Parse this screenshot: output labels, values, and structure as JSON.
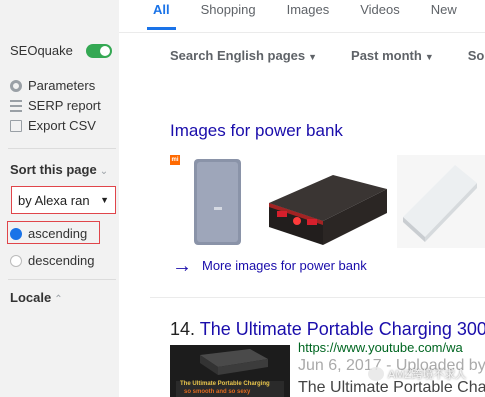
{
  "tabs": [
    "All",
    "Shopping",
    "Images",
    "Videos",
    "New"
  ],
  "filters": [
    "Search English pages",
    "Past month",
    "Sorte"
  ],
  "sidebar": {
    "title": "SEOquake",
    "toggle_on": true,
    "menu": [
      "Parameters",
      "SERP report",
      "Export CSV"
    ],
    "sort_heading": "Sort this page",
    "sort_value": "by Alexa ran",
    "radios": [
      "ascending",
      "descending"
    ],
    "selected_radio": "ascending",
    "locale_heading": "Locale"
  },
  "images_block": {
    "title": "Images for power bank",
    "more_link": "More images for power bank",
    "badge": "mi"
  },
  "result": {
    "number": "14.",
    "title": "The Ultimate Portable Charging 300",
    "url": "https://www.youtube.com/wa",
    "meta": "Jun 6, 2017 - Uploaded by",
    "desc": "The Ultimate Portable Cha",
    "thumb_line1": "The Ultimate Portable Charging",
    "thumb_line2": "so smooth and so sexy"
  },
  "watermark": "AMZ跨境不求人",
  "colors": {
    "accent": "#1a73e8",
    "link": "#1a0dab",
    "url_green": "#006621",
    "highlight_red": "#e0454a",
    "toggle_green": "#34a853"
  }
}
